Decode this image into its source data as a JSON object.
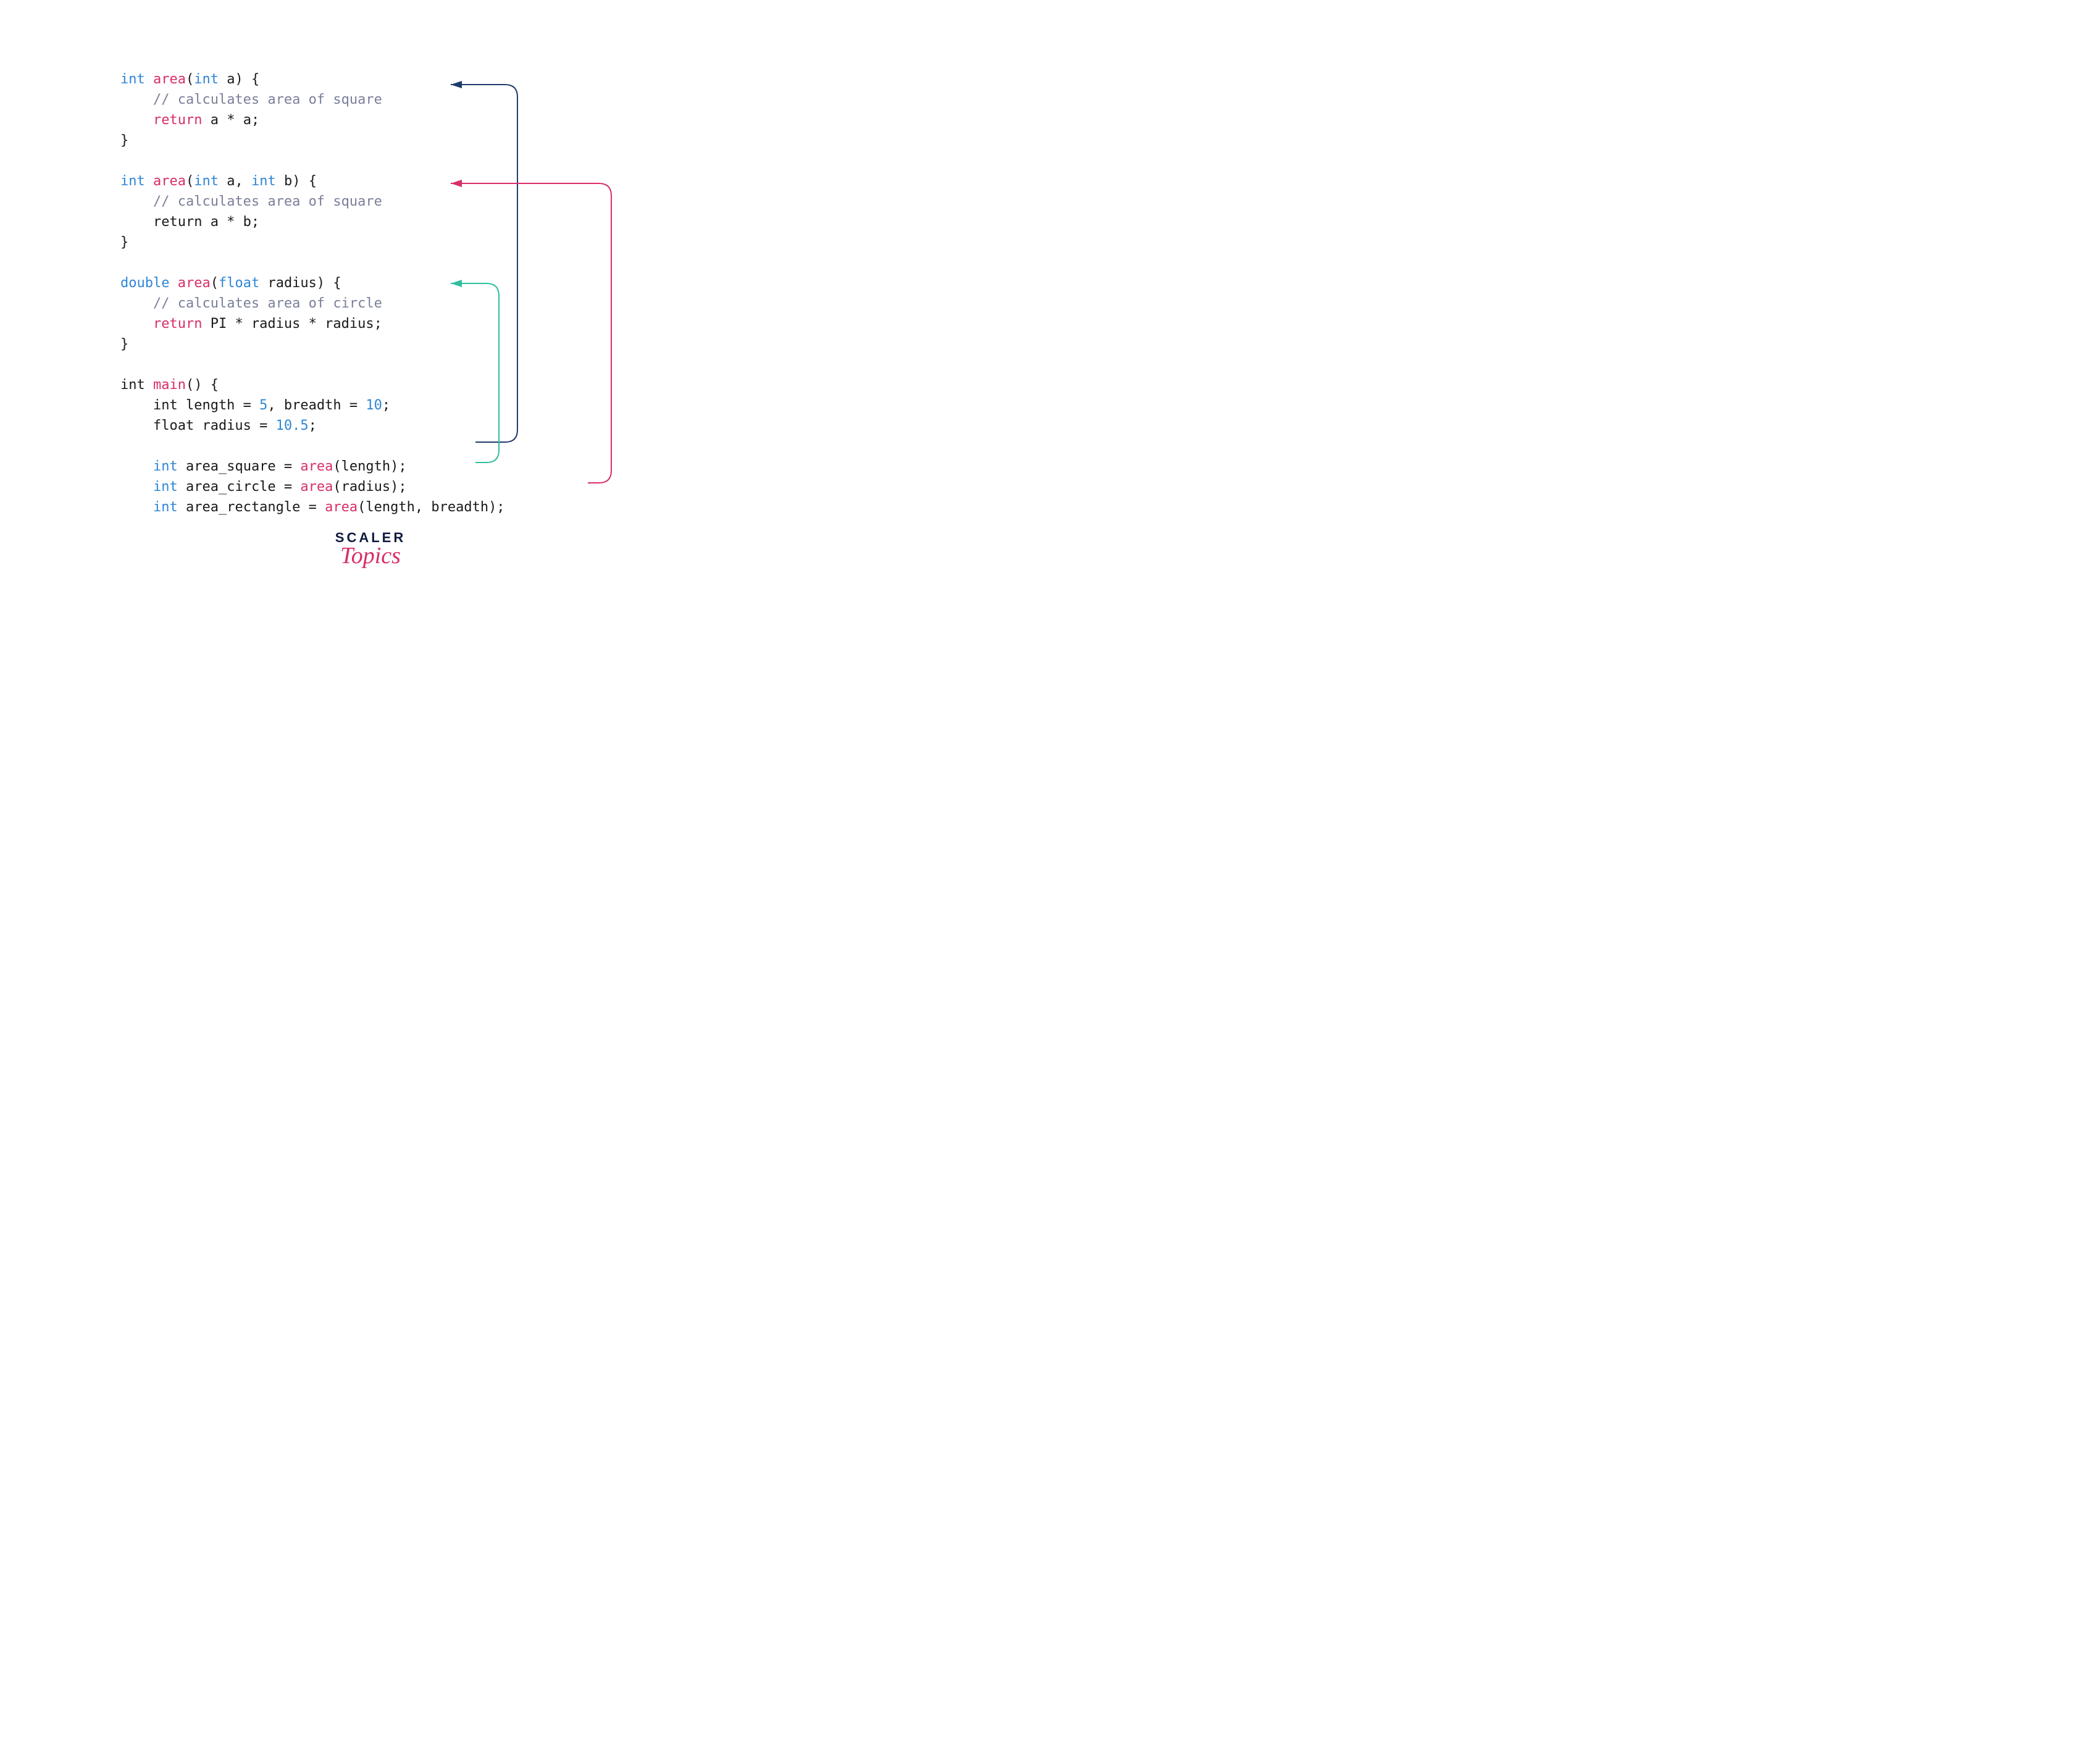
{
  "code": {
    "fn1": {
      "sig_type1": "int",
      "sig_name": "area",
      "sig_param_type": "int",
      "sig_param_name": " a",
      "sig_tail": ") {",
      "comment": "// calculates area of square",
      "ret_kw": "return",
      "ret_expr": " a * a;",
      "close": "}"
    },
    "fn2": {
      "sig_type1": "int",
      "sig_name": "area",
      "sig_param1_type": "int",
      "sig_param1_name": " a, ",
      "sig_param2_type": "int",
      "sig_param2_name": " b",
      "sig_tail": ") {",
      "comment": "// calculates area of square",
      "ret_line": "    return a * b;",
      "close": "}"
    },
    "fn3": {
      "sig_type1": "double",
      "sig_name": "area",
      "sig_param_type": "float",
      "sig_param_name": " radius",
      "sig_tail": ") {",
      "comment": "// calculates area of circle",
      "ret_kw": "return",
      "ret_expr": " PI * radius * radius;",
      "close": "}"
    },
    "main": {
      "sig": "int ",
      "sig_name": "main",
      "sig_tail": "() {",
      "decl1a": "    int length = ",
      "decl1_num1": "5",
      "decl1b": ", breadth = ",
      "decl1_num2": "10",
      "decl1c": ";",
      "decl2a": "    float radius = ",
      "decl2_num": "10.5",
      "decl2b": ";",
      "call1_type": "int",
      "call1_mid": " area_square = ",
      "call1_fn": "area",
      "call1_args": "(length);",
      "call2_type": "int",
      "call2_mid": " area_circle = ",
      "call2_fn": "area",
      "call2_args": "(radius);",
      "call3_type": "int",
      "call3_mid": " area_rectangle = ",
      "call3_fn": "area",
      "call3_args": "(length, breadth);"
    }
  },
  "arrows": {
    "colors": {
      "navy": "#1f3a6b",
      "pink": "#d82e6a",
      "teal": "#2fbfa0"
    }
  },
  "logo": {
    "line1": "SCALER",
    "line2": "Topics"
  }
}
